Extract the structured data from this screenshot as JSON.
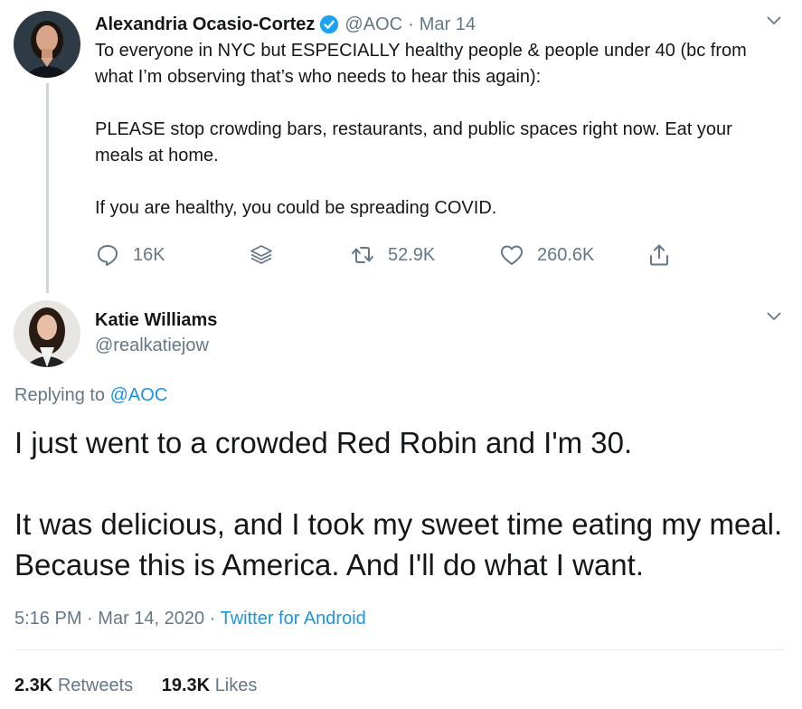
{
  "tweet1": {
    "author_name": "Alexandria Ocasio-Cortez",
    "handle": "@AOC",
    "separator": "·",
    "date": "Mar 14",
    "paragraphs": [
      "To everyone in NYC but ESPECIALLY healthy people & people under 40 (bc from what I’m observing that’s who needs to hear this again):",
      "PLEASE stop crowding bars, restaurants, and public spaces right now. Eat your meals at home.",
      "If you are healthy, you could be spreading COVID."
    ],
    "actions": {
      "reply_count": "16K",
      "retweet_count": "52.9K",
      "like_count": "260.6K"
    },
    "icons": [
      "verified-icon",
      "reply-icon",
      "layers-icon",
      "retweet-icon",
      "like-icon",
      "share-icon",
      "chevron-down-icon"
    ]
  },
  "tweet2": {
    "author_name": "Katie Williams",
    "handle": "@realkatiejow",
    "replying_prefix": "Replying to",
    "replying_to": "@AOC",
    "paragraphs": [
      "I just went to a crowded Red Robin and I'm 30.",
      "It was delicious, and I took my sweet time eating my meal. Because this is America. And I'll do what I want."
    ],
    "time": "5:16 PM",
    "separator": "·",
    "full_date": "Mar 14, 2020",
    "source": "Twitter for Android",
    "stats": {
      "retweets_count": "2.3K",
      "retweets_label": "Retweets",
      "likes_count": "19.3K",
      "likes_label": "Likes"
    }
  },
  "colors": {
    "text_primary": "#14171a",
    "text_secondary": "#657786",
    "link": "#1b95e0",
    "verified": "#1da1f2",
    "thread_line": "#ccd6dd",
    "divider": "#e6ecf0"
  }
}
